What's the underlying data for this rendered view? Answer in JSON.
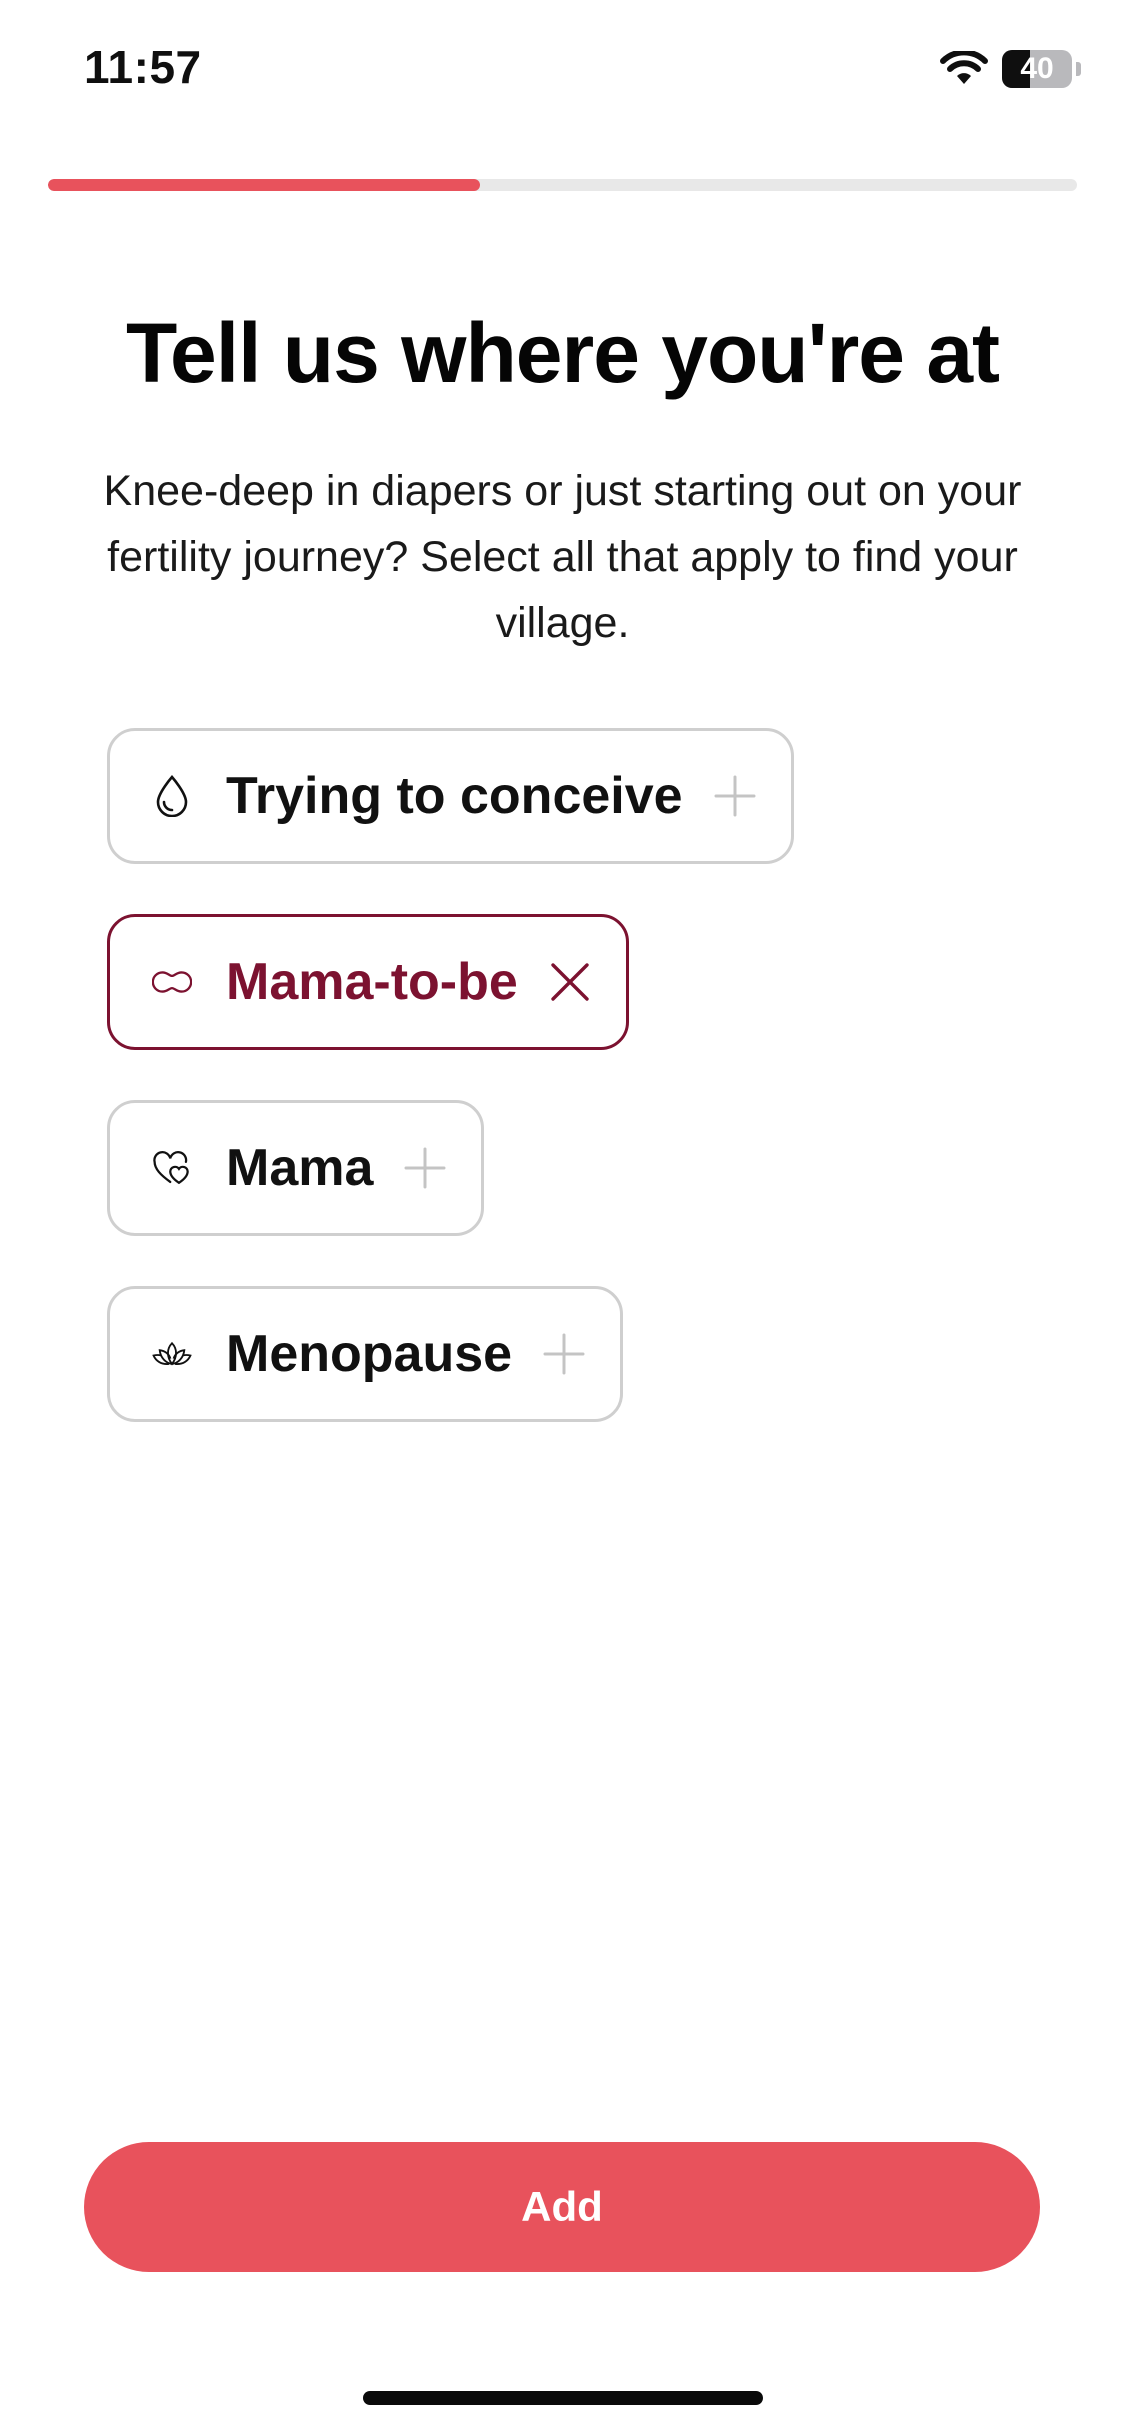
{
  "status_bar": {
    "time": "11:57",
    "battery_level": "40"
  },
  "onboarding": {
    "progress": 0.42
  },
  "content": {
    "title": "Tell us where you're at",
    "subtitle": "Knee-deep in diapers or just starting out on your fertility journey? Select all that apply to find your village."
  },
  "options": [
    {
      "label": "Trying to conceive",
      "icon": "droplet-icon",
      "selected": false,
      "action_icon": "plus-icon"
    },
    {
      "label": "Mama-to-be",
      "icon": "pill-shape-icon",
      "selected": true,
      "action_icon": "close-icon"
    },
    {
      "label": "Mama",
      "icon": "hearts-icon",
      "selected": false,
      "action_icon": "plus-icon"
    },
    {
      "label": "Menopause",
      "icon": "lotus-icon",
      "selected": false,
      "action_icon": "plus-icon"
    }
  ],
  "footer": {
    "add_label": "Add"
  },
  "colors": {
    "accent": "#e8525c",
    "selected": "#7c1230",
    "border": "#cfcfcf",
    "track": "#e8e8e8"
  }
}
